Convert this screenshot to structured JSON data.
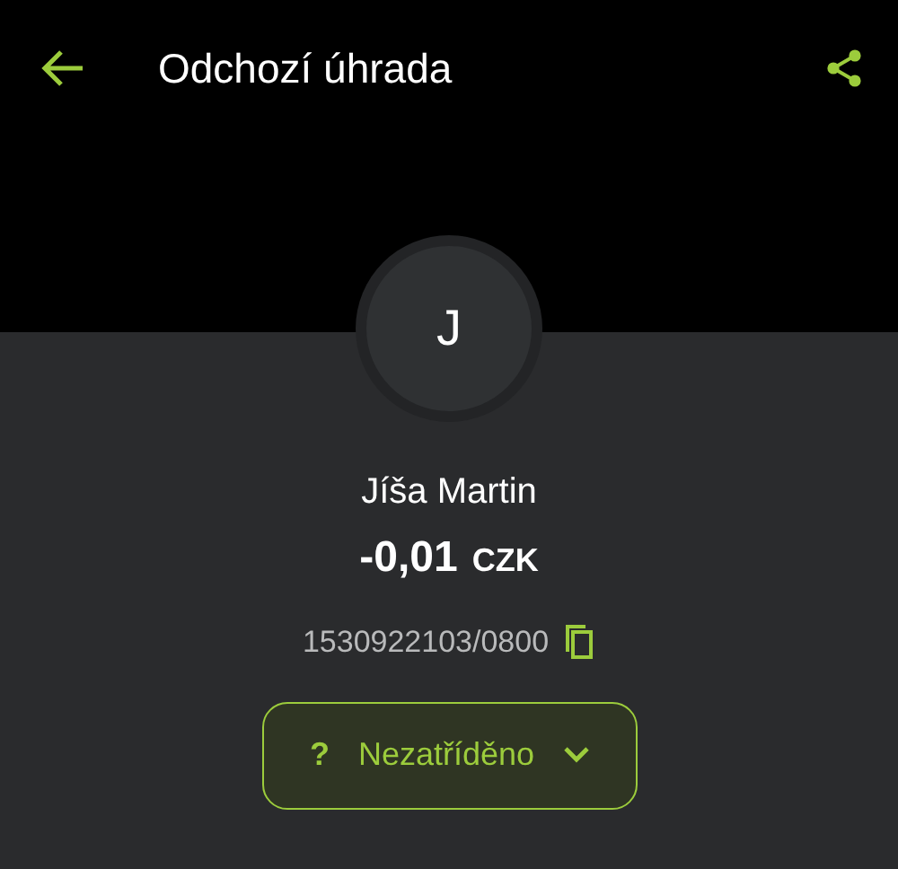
{
  "header": {
    "title": "Odchozí úhrada"
  },
  "counterparty": {
    "initial": "J",
    "name": "Jíša Martin",
    "amount": "-0,01",
    "currency": "CZK",
    "account": "1530922103/0800"
  },
  "category": {
    "symbol": "?",
    "label": "Nezatříděno",
    "expanded": false
  }
}
